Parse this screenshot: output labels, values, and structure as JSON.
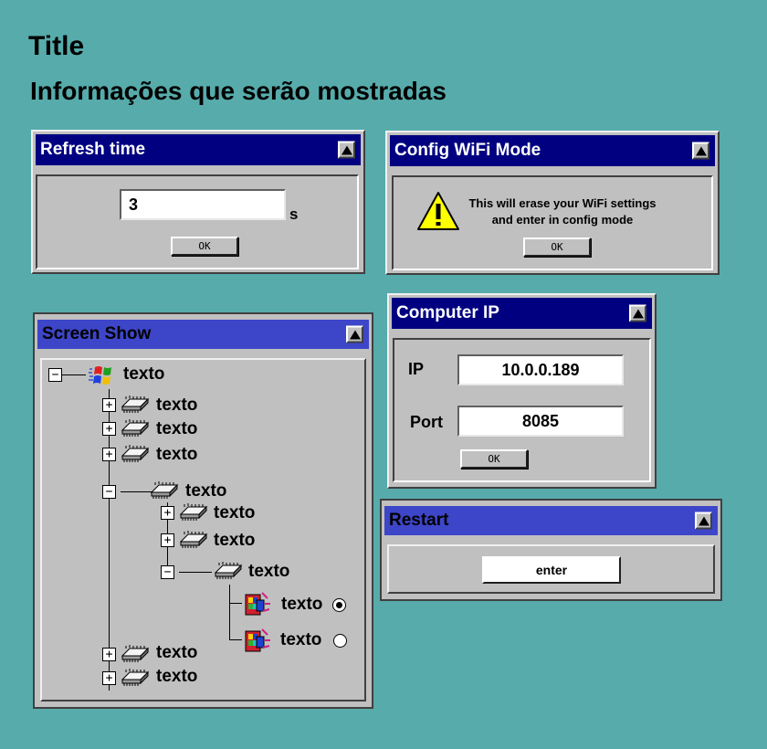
{
  "page": {
    "title": "Title",
    "subtitle": "Informações que serão mostradas"
  },
  "refresh_window": {
    "title": "Refresh time",
    "value": "3",
    "unit": "s",
    "ok_label": "OK"
  },
  "wifi_window": {
    "title": "Config WiFi Mode",
    "message_line1": "This will erase your WiFi settings",
    "message_line2": "and enter in config mode",
    "ok_label": "OK"
  },
  "ip_window": {
    "title": "Computer IP",
    "ip_label": "IP",
    "ip_value": "10.0.0.189",
    "port_label": "Port",
    "port_value": "8085",
    "ok_label": "OK"
  },
  "restart_window": {
    "title": "Restart",
    "button_label": "enter"
  },
  "screen_show": {
    "title": "Screen Show",
    "nodes": [
      {
        "label": "texto",
        "icon": "windows-logo-icon",
        "expander": "−"
      },
      {
        "label": "texto",
        "icon": "chip-icon",
        "expander": "+"
      },
      {
        "label": "texto",
        "icon": "chip-icon",
        "expander": "+"
      },
      {
        "label": "texto",
        "icon": "chip-icon",
        "expander": "+"
      },
      {
        "label": "texto",
        "icon": "chip-icon",
        "expander": "−"
      },
      {
        "label": "texto",
        "icon": "chip-icon",
        "expander": "+"
      },
      {
        "label": "texto",
        "icon": "chip-icon",
        "expander": "+"
      },
      {
        "label": "texto",
        "icon": "chip-icon",
        "expander": "−"
      },
      {
        "label": "texto",
        "icon": "app-icon",
        "radio": "selected"
      },
      {
        "label": "texto",
        "icon": "app-icon",
        "radio": "unselected"
      },
      {
        "label": "texto",
        "icon": "chip-icon",
        "expander": "+"
      },
      {
        "label": "texto",
        "icon": "chip-icon",
        "expander": "+"
      }
    ]
  }
}
